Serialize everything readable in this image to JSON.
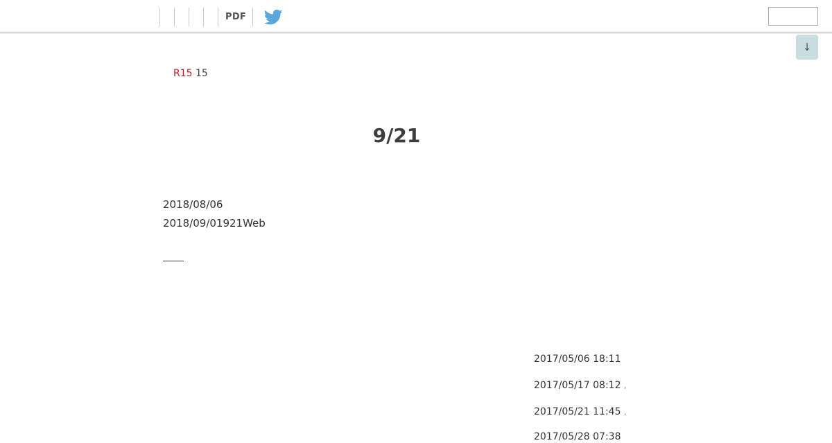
{
  "toolbar": {
    "pdf_label": "PDF"
  },
  "icons": {
    "twitter_color": "#5aa7dd",
    "scroll_down_glyph": "↓"
  },
  "colors": {
    "scroll_button_bg": "#c9dde0",
    "rating_red": "#b22222"
  },
  "search": {
    "value": ""
  },
  "rating": {
    "tag": "R15",
    "value": "15"
  },
  "main": {
    "title": "9/21",
    "date_line": "2018/08/06",
    "note_line": "2018/09/01921Web"
  },
  "history": [
    {
      "timestamp": "2017/05/06 18:11",
      "suffix": ""
    },
    {
      "timestamp": "2017/05/17 08:12",
      "suffix": ","
    },
    {
      "timestamp": "2017/05/21 11:45",
      "suffix": ","
    },
    {
      "timestamp": "2017/05/28 07:38",
      "suffix": ""
    }
  ]
}
